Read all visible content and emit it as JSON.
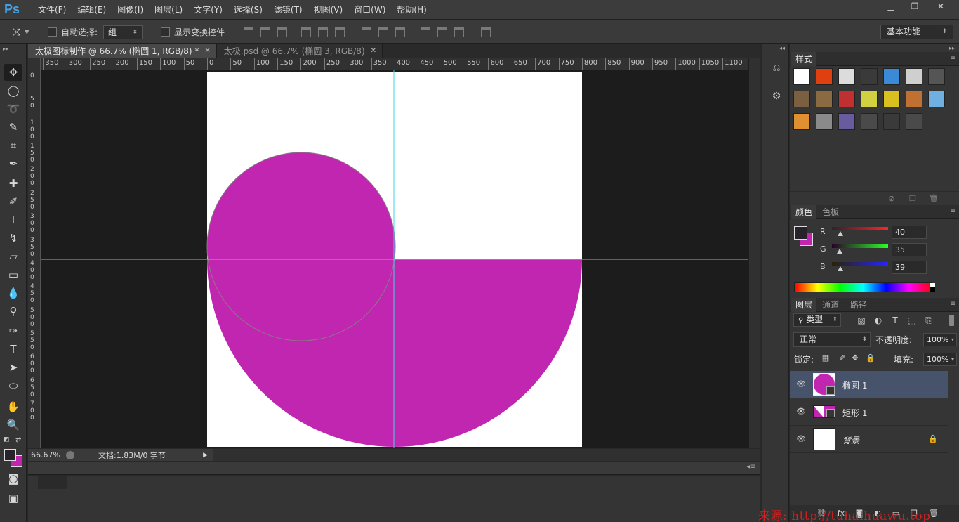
{
  "app": {
    "logo": "Ps",
    "menu": [
      "文件(F)",
      "编辑(E)",
      "图像(I)",
      "图层(L)",
      "文字(Y)",
      "选择(S)",
      "滤镜(T)",
      "视图(V)",
      "窗口(W)",
      "帮助(H)"
    ],
    "window_controls": [
      "minimize-icon",
      "restore-icon",
      "close-icon"
    ]
  },
  "options": {
    "auto_select_label": "自动选择:",
    "auto_select_value": "组",
    "show_transform_label": "显示变换控件",
    "workspace": "基本功能"
  },
  "tabs": [
    {
      "label": "太极图标制作 @ 66.7% (椭圆 1, RGB/8) *",
      "active": true
    },
    {
      "label": "太极.psd @ 66.7% (椭圆 3, RGB/8)",
      "active": false
    }
  ],
  "ruler": {
    "top": [
      "350",
      "300",
      "250",
      "200",
      "150",
      "100",
      "50",
      "0",
      "50",
      "100",
      "150",
      "200",
      "250",
      "300",
      "350",
      "400",
      "450",
      "500",
      "550",
      "600",
      "650",
      "700",
      "750",
      "800",
      "850",
      "900",
      "950",
      "1000",
      "1050",
      "1100"
    ],
    "left": [
      "0",
      "50",
      "100",
      "150",
      "200",
      "250",
      "300",
      "350",
      "400",
      "450",
      "500",
      "550",
      "600",
      "650",
      "700"
    ]
  },
  "status": {
    "zoom": "66.67%",
    "doc_info": "文档:1.83M/0 字节"
  },
  "canvas": {
    "shape_color": "#c126b0",
    "guide_color": "#3fd6e6"
  },
  "colors": {
    "foreground": "#28232a",
    "background": "#c126b0"
  },
  "styles_panel": {
    "tab": "样式"
  },
  "color_panel": {
    "tabs": [
      "颜色",
      "色板"
    ],
    "channels": [
      {
        "label": "R",
        "value": "40"
      },
      {
        "label": "G",
        "value": "35"
      },
      {
        "label": "B",
        "value": "39"
      }
    ]
  },
  "layers_panel": {
    "tabs": [
      "图层",
      "通道",
      "路径"
    ],
    "kind_filter": "类型",
    "blend_mode": "正常",
    "opacity_label": "不透明度:",
    "opacity": "100%",
    "lock_label": "锁定:",
    "fill_label": "填充:",
    "fill": "100%",
    "layers": [
      {
        "name": "椭圆 1",
        "selected": true
      },
      {
        "name": "矩形 1",
        "selected": false
      },
      {
        "name": "背景",
        "selected": false
      }
    ]
  },
  "watermark": "来源: http://tuhaihuawu.top"
}
